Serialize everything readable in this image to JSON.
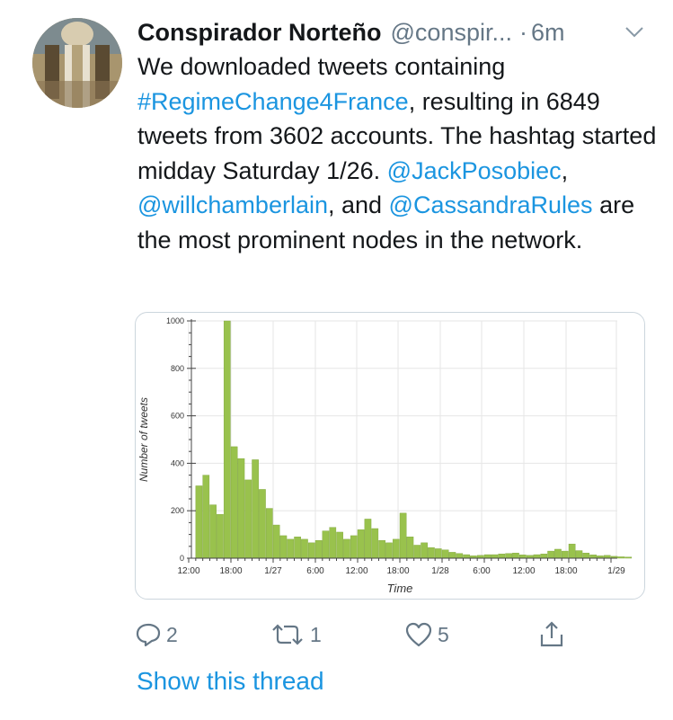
{
  "tweet": {
    "author_name": "Conspirador Norteño",
    "handle": "@conspir...",
    "separator": "·",
    "time": "6m",
    "text_segments": [
      {
        "text": "We downloaded tweets containing ",
        "type": "plain"
      },
      {
        "text": "#RegimeChange4France",
        "type": "link"
      },
      {
        "text": ", resulting in 6849 tweets from 3602 accounts. The hashtag started midday Saturday 1/26. ",
        "type": "plain"
      },
      {
        "text": "@JackPosobiec",
        "type": "link"
      },
      {
        "text": ", ",
        "type": "plain"
      },
      {
        "text": "@willchamberlain",
        "type": "link"
      },
      {
        "text": ", and ",
        "type": "plain"
      },
      {
        "text": "@CassandraRules",
        "type": "link"
      },
      {
        "text": " are the most prominent nodes in the network.",
        "type": "plain"
      }
    ],
    "show_thread_label": "Show this thread"
  },
  "actions": {
    "reply_count": "2",
    "retweet_count": "1",
    "like_count": "5"
  },
  "icons": {
    "reply": "reply-icon",
    "retweet": "retweet-icon",
    "like": "heart-icon",
    "share": "share-icon",
    "menu": "chevron-down-icon"
  },
  "colors": {
    "link": "#1b95e0",
    "muted": "#657786",
    "bar": "#99c24d"
  },
  "chart_data": {
    "type": "bar",
    "xlabel": "Time",
    "ylabel": "Number of tweets",
    "ylim": [
      0,
      1000
    ],
    "yticks": [
      0,
      200,
      400,
      600,
      800,
      1000
    ],
    "xticks": [
      "12:00",
      "18:00",
      "1/27",
      "6:00",
      "12:00",
      "18:00",
      "1/28",
      "6:00",
      "12:00",
      "18:00",
      "1/29"
    ],
    "bin_hours": 1,
    "x_start": "1/26 13:00",
    "values": [
      305,
      350,
      225,
      185,
      1000,
      470,
      420,
      330,
      415,
      290,
      210,
      140,
      95,
      80,
      90,
      80,
      65,
      75,
      115,
      130,
      110,
      80,
      95,
      120,
      165,
      125,
      75,
      65,
      80,
      190,
      90,
      55,
      65,
      45,
      40,
      35,
      25,
      20,
      15,
      10,
      12,
      15,
      15,
      18,
      20,
      22,
      14,
      12,
      15,
      18,
      30,
      38,
      30,
      60,
      32,
      22,
      14,
      10,
      12,
      8,
      6,
      5
    ]
  }
}
